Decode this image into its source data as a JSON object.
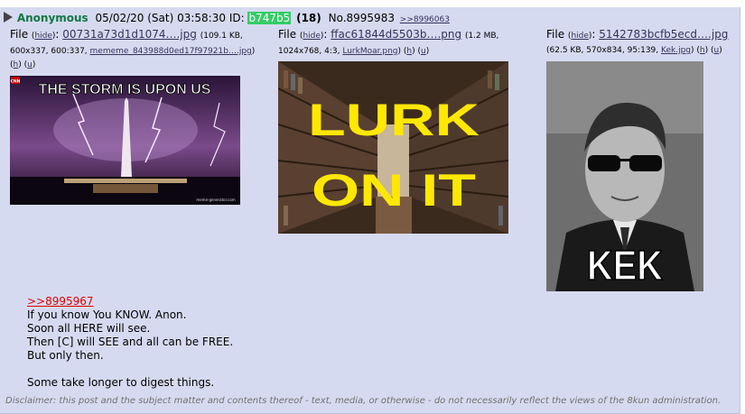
{
  "post": {
    "name": "Anonymous",
    "date": "05/02/20 (Sat) 03:58:30",
    "id_label": "ID:",
    "id_value": "b747b5",
    "count": "(18)",
    "post_no": "No.8995983",
    "backlink": ">>8996063"
  },
  "files": [
    {
      "label": "File",
      "hide": "hide",
      "filename": "00731a73d1d1074….jpg",
      "meta_a": "(109.1 KB,",
      "meta_b": "600x337, 600:337,",
      "original": "mememe_843988d0ed17f97921b….jpg",
      "meta_close": ")",
      "h": "h",
      "u": "u",
      "thumb_text": "THE STORM IS UPON US",
      "badge": "CNN",
      "watermark": "meme-generator.com"
    },
    {
      "label": "File",
      "hide": "hide",
      "filename": "ffac61844d5503b….png",
      "meta_a": "(1.2 MB,",
      "meta_b": "1024x768, 4:3,",
      "original": "LurkMoar.png",
      "meta_close": ")",
      "h": "h",
      "u": "u",
      "thumb_line1": "LURK",
      "thumb_line2": "ON IT"
    },
    {
      "label": "File",
      "hide": "hide",
      "filename": "5142783bcfb5ecd….jpg",
      "meta_a": "(62.5 KB, 570x834, 95:139,",
      "original": "Kek.jpg",
      "meta_close": ")",
      "h": "h",
      "u": "u",
      "thumb_text": "KEK"
    }
  ],
  "body": {
    "quote": ">>8995967",
    "lines": [
      "If you know You KNOW. Anon.",
      "Soon all HERE will see.",
      "Then [C] will SEE and all can be FREE.",
      "But only then.",
      "",
      "Some take longer to digest things."
    ]
  },
  "disclaimer": "Disclaimer: this post and the subject matter and contents thereof - text, media, or otherwise - do not necessarily reflect the views of the 8kun administration.",
  "colors": {
    "post_bg": "#d6daf0",
    "name": "#117743",
    "id_bg": "#33cc66",
    "link": "#34345c",
    "quote": "#dd0000"
  }
}
